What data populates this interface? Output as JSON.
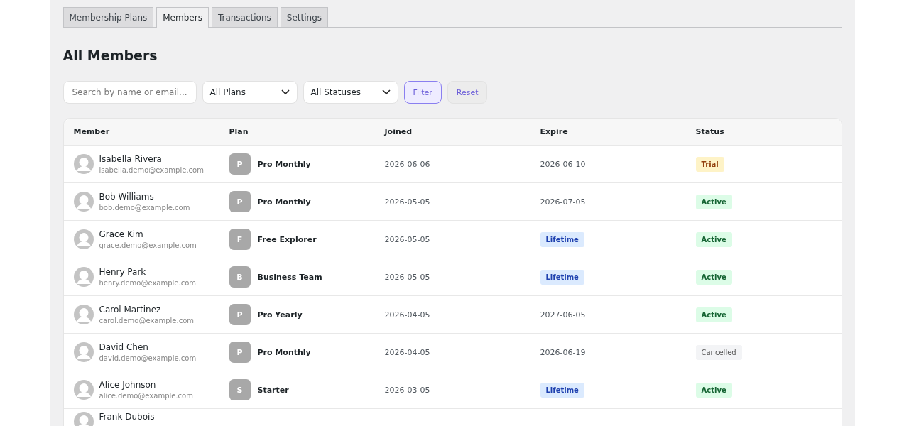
{
  "tabs": [
    {
      "label": "Membership Plans",
      "selected": false
    },
    {
      "label": "Members",
      "selected": true
    },
    {
      "label": "Transactions",
      "selected": false
    },
    {
      "label": "Settings",
      "selected": false
    }
  ],
  "heading": "All Members",
  "filters": {
    "search": {
      "placeholder": "Search by name or email..."
    },
    "plan_select": "All Plans",
    "status_select": "All Statuses",
    "filter_button": "Filter",
    "reset_button": "Reset"
  },
  "table": {
    "columns": [
      "Member",
      "Plan",
      "Joined",
      "Expire",
      "Status"
    ],
    "rows": [
      {
        "name": "Isabella Rivera",
        "email": "isabella.demo@example.com",
        "plan_initial": "P",
        "plan": "Pro Monthly",
        "joined": "2026-06-06",
        "expire": {
          "kind": "date",
          "text": "2026-06-10"
        },
        "status": {
          "kind": "trial",
          "text": "Trial"
        }
      },
      {
        "name": "Bob Williams",
        "email": "bob.demo@example.com",
        "plan_initial": "P",
        "plan": "Pro Monthly",
        "joined": "2026-05-05",
        "expire": {
          "kind": "date",
          "text": "2026-07-05"
        },
        "status": {
          "kind": "active",
          "text": "Active"
        }
      },
      {
        "name": "Grace Kim",
        "email": "grace.demo@example.com",
        "plan_initial": "F",
        "plan": "Free Explorer",
        "joined": "2026-05-05",
        "expire": {
          "kind": "lifetime",
          "text": "Lifetime"
        },
        "status": {
          "kind": "active",
          "text": "Active"
        }
      },
      {
        "name": "Henry Park",
        "email": "henry.demo@example.com",
        "plan_initial": "B",
        "plan": "Business Team",
        "joined": "2026-05-05",
        "expire": {
          "kind": "lifetime",
          "text": "Lifetime"
        },
        "status": {
          "kind": "active",
          "text": "Active"
        }
      },
      {
        "name": "Carol Martinez",
        "email": "carol.demo@example.com",
        "plan_initial": "P",
        "plan": "Pro Yearly",
        "joined": "2026-04-05",
        "expire": {
          "kind": "date",
          "text": "2027-06-05"
        },
        "status": {
          "kind": "active",
          "text": "Active"
        }
      },
      {
        "name": "David Chen",
        "email": "david.demo@example.com",
        "plan_initial": "P",
        "plan": "Pro Monthly",
        "joined": "2026-04-05",
        "expire": {
          "kind": "date",
          "text": "2026-06-19"
        },
        "status": {
          "kind": "cancelled",
          "text": "Cancelled"
        }
      },
      {
        "name": "Alice Johnson",
        "email": "alice.demo@example.com",
        "plan_initial": "S",
        "plan": "Starter",
        "joined": "2026-03-05",
        "expire": {
          "kind": "lifetime",
          "text": "Lifetime"
        },
        "status": {
          "kind": "active",
          "text": "Active"
        }
      },
      {
        "name": "Frank Dubois"
      }
    ]
  }
}
